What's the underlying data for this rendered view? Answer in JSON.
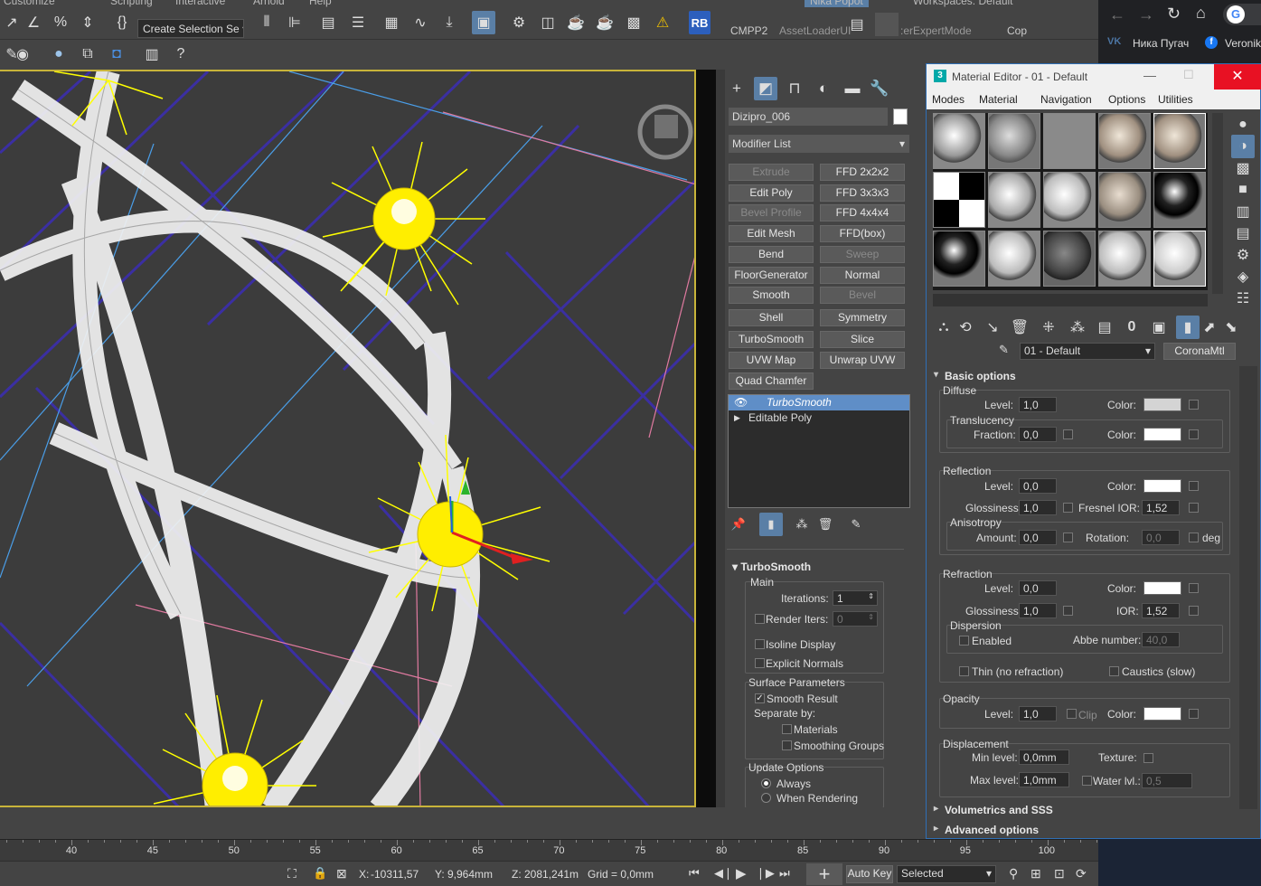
{
  "menu": {
    "items": [
      "Customize",
      "Scripting",
      "Interactive",
      "Arnold",
      "Help"
    ],
    "user": "Nika Popot",
    "workspaces": "Workspaces: Default"
  },
  "toolbar": {
    "create_selection_set": "Create Selection Se",
    "rb_label": "RB",
    "cmpp2_label": "CMPP2",
    "asset_loader_label": "AssetLoaderUI",
    "expert_mode_label": ":erExpertMode",
    "cop_label": "Cop"
  },
  "command_panel": {
    "object_name": "Dizipro_006",
    "object_color": "#ffffff",
    "modifier_list_label": "Modifier List",
    "modifier_buttons": [
      {
        "label": "Extrude",
        "enabled": false
      },
      {
        "label": "FFD 2x2x2",
        "enabled": true
      },
      {
        "label": "Edit Poly",
        "enabled": true
      },
      {
        "label": "FFD 3x3x3",
        "enabled": true
      },
      {
        "label": "Bevel Profile",
        "enabled": false
      },
      {
        "label": "FFD 4x4x4",
        "enabled": true
      },
      {
        "label": "Edit Mesh",
        "enabled": true
      },
      {
        "label": "FFD(box)",
        "enabled": true
      },
      {
        "label": "Bend",
        "enabled": true
      },
      {
        "label": "Sweep",
        "enabled": false
      },
      {
        "label": "FloorGenerator",
        "enabled": true
      },
      {
        "label": "Normal",
        "enabled": true
      },
      {
        "label": "Smooth",
        "enabled": true
      },
      {
        "label": "Bevel",
        "enabled": false
      },
      {
        "label": "Shell",
        "enabled": true
      },
      {
        "label": "Symmetry",
        "enabled": true
      },
      {
        "label": "TurboSmooth",
        "enabled": true
      },
      {
        "label": "Slice",
        "enabled": true
      },
      {
        "label": "UVW Map",
        "enabled": true
      },
      {
        "label": "Unwrap UVW",
        "enabled": true
      },
      {
        "label": "Quad Chamfer",
        "enabled": true
      }
    ],
    "stack": [
      {
        "label": "TurboSmooth",
        "selected": true
      },
      {
        "label": "Editable Poly",
        "selected": false
      }
    ],
    "turbosmooth": {
      "title": "TurboSmooth",
      "main_label": "Main",
      "iterations_label": "Iterations:",
      "iterations_value": "1",
      "render_iters_label": "Render Iters:",
      "render_iters_value": "0",
      "isoline_label": "Isoline Display",
      "explicit_normals_label": "Explicit Normals",
      "surface_params_label": "Surface Parameters",
      "smooth_result_label": "Smooth Result",
      "separate_by_label": "Separate by:",
      "materials_label": "Materials",
      "smoothing_groups_label": "Smoothing Groups",
      "update_options_label": "Update Options",
      "always_label": "Always",
      "when_rendering_label": "When Rendering"
    }
  },
  "material_editor": {
    "title": "Material Editor - 01 - Default",
    "menu": [
      "Modes",
      "Material",
      "Navigation",
      "Options",
      "Utilities"
    ],
    "material_name": "01 - Default",
    "material_type": "CoronaMtl",
    "basic_options": {
      "title": "Basic options",
      "diffuse": {
        "label": "Diffuse",
        "level_label": "Level:",
        "level": "1,0",
        "color_label": "Color:",
        "color": "#d4d4d4",
        "translucency_label": "Translucency",
        "fraction_label": "Fraction:",
        "fraction": "0,0",
        "trans_color": "#ffffff"
      },
      "reflection": {
        "label": "Reflection",
        "level_label": "Level:",
        "level": "0,0",
        "color_label": "Color:",
        "color": "#ffffff",
        "glossiness_label": "Glossiness:",
        "glossiness": "1,0",
        "fresnel_label": "Fresnel IOR:",
        "fresnel": "1,52",
        "anisotropy_label": "Anisotropy",
        "amount_label": "Amount:",
        "amount": "0,0",
        "rotation_label": "Rotation:",
        "rotation": "0,0",
        "deg_label": "deg"
      },
      "refraction": {
        "label": "Refraction",
        "level_label": "Level:",
        "level": "0,0",
        "color_label": "Color:",
        "color": "#ffffff",
        "glossiness_label": "Glossiness:",
        "glossiness": "1,0",
        "ior_label": "IOR:",
        "ior": "1,52",
        "dispersion_label": "Dispersion",
        "enabled_label": "Enabled",
        "abbe_label": "Abbe number:",
        "abbe": "40,0",
        "thin_label": "Thin (no refraction)",
        "caustics_label": "Caustics (slow)"
      },
      "opacity": {
        "label": "Opacity",
        "level_label": "Level:",
        "level": "1,0",
        "clip_label": "Clip",
        "color_label": "Color:",
        "color": "#ffffff"
      },
      "displacement": {
        "label": "Displacement",
        "min_label": "Min level:",
        "min": "0,0mm",
        "texture_label": "Texture:",
        "max_label": "Max level:",
        "max": "1,0mm",
        "water_label": "Water lvl.:",
        "water": "0,5"
      }
    },
    "volumetrics_label": "Volumetrics and SSS",
    "advanced_label": "Advanced options"
  },
  "browser": {
    "tab1": "Ника Пугач",
    "tab2": "Veronik"
  },
  "timeline": {
    "ticks": [
      "40",
      "45",
      "50",
      "55",
      "60",
      "65",
      "70",
      "75",
      "80",
      "85",
      "90",
      "95",
      "100"
    ]
  },
  "status": {
    "x_label": "X:",
    "x_value": "-10311,57",
    "y_label": "Y:",
    "y_value": "9,964mm",
    "z_label": "Z:",
    "z_value": "2081,241m",
    "grid": "Grid = 0,0mm",
    "auto_key": "Auto Key",
    "selected": "Selected"
  }
}
